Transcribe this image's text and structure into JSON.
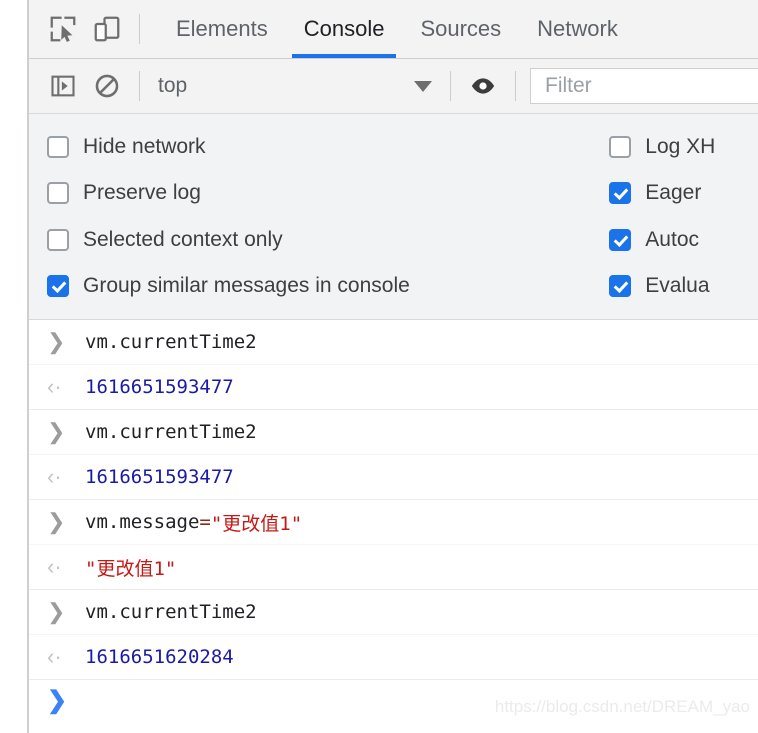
{
  "toolbar": {
    "inspect_icon": "inspect-element-icon",
    "device_icon": "device-toolbar-icon",
    "tabs": [
      {
        "label": "Elements",
        "active": false
      },
      {
        "label": "Console",
        "active": true
      },
      {
        "label": "Sources",
        "active": false
      },
      {
        "label": "Network",
        "active": false
      }
    ]
  },
  "console_toolbar": {
    "sidebar_icon": "console-sidebar-icon",
    "clear_icon": "clear-console-icon",
    "context": "top",
    "eye_icon": "live-expression-eye-icon",
    "filter_placeholder": "Filter"
  },
  "settings": {
    "left": [
      {
        "label": "Hide network",
        "checked": false
      },
      {
        "label": "Preserve log",
        "checked": false
      },
      {
        "label": "Selected context only",
        "checked": false
      },
      {
        "label": "Group similar messages in console",
        "checked": true
      }
    ],
    "right": [
      {
        "label": "Log XH",
        "checked": false
      },
      {
        "label": "Eager",
        "checked": true
      },
      {
        "label": "Autoc",
        "checked": true
      },
      {
        "label": "Evalua",
        "checked": true
      }
    ]
  },
  "console": {
    "input_marker": "❯",
    "output_marker": "‹·",
    "entries": [
      {
        "input": {
          "code": "vm.currentTime2"
        },
        "output": {
          "value": "1616651593477",
          "kind": "number"
        }
      },
      {
        "input": {
          "code": "vm.currentTime2"
        },
        "output": {
          "value": "1616651593477",
          "kind": "number"
        }
      },
      {
        "input": {
          "prefix": "vm.message",
          "operator": "=",
          "string": "\"更改值1\""
        },
        "output": {
          "value": "\"更改值1\"",
          "kind": "string"
        }
      },
      {
        "input": {
          "code": "vm.currentTime2"
        },
        "output": {
          "value": "1616651620284",
          "kind": "number"
        }
      }
    ],
    "prompt": "❯"
  },
  "watermark": "https://blog.csdn.net/DREAM_yao",
  "colors": {
    "accent": "#1a73e8",
    "number": "#1a1aa6",
    "string": "#c41a16",
    "operator": "#8b2a14",
    "panel_bg": "#f1f3f4",
    "toolbar_bg": "#f3f3f3"
  }
}
